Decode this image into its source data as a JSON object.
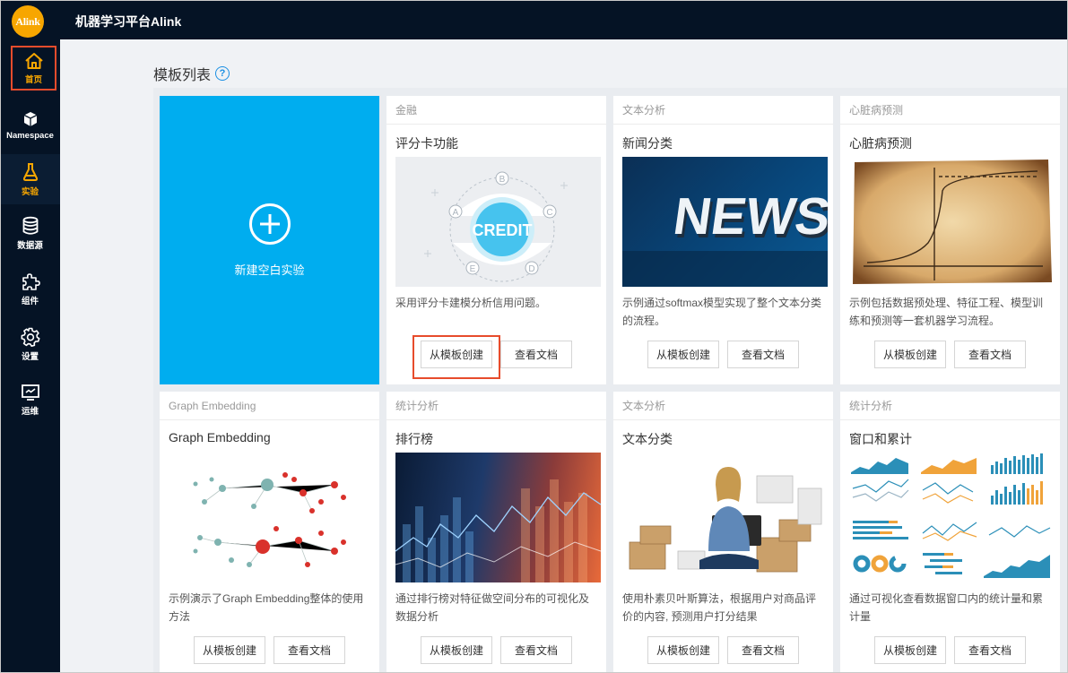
{
  "app": {
    "title": "机器学习平台Alink",
    "logo_text": "Alink"
  },
  "sidebar": {
    "items": [
      {
        "label": "首页",
        "icon": "home-icon"
      },
      {
        "label": "Namespace",
        "icon": "cube-icon"
      },
      {
        "label": "实验",
        "icon": "flask-icon"
      },
      {
        "label": "数据源",
        "icon": "database-icon"
      },
      {
        "label": "组件",
        "icon": "puzzle-icon"
      },
      {
        "label": "设置",
        "icon": "gear-icon"
      },
      {
        "label": "运维",
        "icon": "monitor-icon"
      }
    ]
  },
  "main": {
    "section_title": "模板列表",
    "help_glyph": "?",
    "new_card_label": "新建空白实验",
    "create_label": "从模板创建",
    "docs_label": "查看文档",
    "cards": [
      {
        "category": "金融",
        "title": "评分卡功能",
        "desc": "采用评分卡建模分析信用问题。",
        "thumb_text": "CREDIT",
        "thumb_letters": [
          "A",
          "B",
          "C",
          "D",
          "E"
        ]
      },
      {
        "category": "文本分析",
        "title": "新闻分类",
        "desc": "示例通过softmax模型实现了整个文本分类的流程。",
        "thumb_text": "NEWS"
      },
      {
        "category": "心脏病预测",
        "title": "心脏病预测",
        "desc": "示例包括数据预处理、特征工程、模型训练和预测等一套机器学习流程。"
      },
      {
        "category": "Graph Embedding",
        "title": "Graph Embedding",
        "desc": "示例演示了Graph Embedding整体的使用方法"
      },
      {
        "category": "统计分析",
        "title": "排行榜",
        "desc": "通过排行榜对特征做空间分布的可视化及数据分析"
      },
      {
        "category": "文本分析",
        "title": "文本分类",
        "desc": "使用朴素贝叶斯算法，根据用户对商品评价的内容, 预测用户打分结果"
      },
      {
        "category": "统计分析",
        "title": "窗口和累计",
        "desc": "通过可视化查看数据窗口内的统计量和累计量"
      }
    ]
  },
  "colors": {
    "sidebar_bg": "#051325",
    "accent": "#f7a600",
    "new_card_bg": "#00adef",
    "highlight": "#e74c2c"
  }
}
